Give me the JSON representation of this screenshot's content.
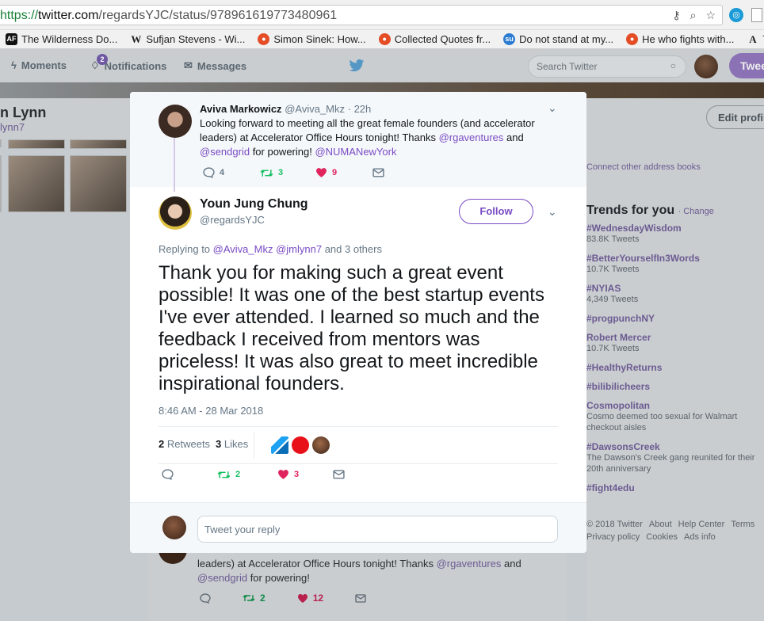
{
  "browser": {
    "url_protocol": "https://",
    "url_host": "twitter.com",
    "url_path": "/regardsYJC/status/978961619773480961",
    "bookmarks": [
      {
        "icon": "AF",
        "label": "The Wilderness Do..."
      },
      {
        "icon": "W",
        "label": "Sufjan Stevens - Wi..."
      },
      {
        "icon": "so",
        "label": "Simon Sinek: How..."
      },
      {
        "icon": "so",
        "label": "Collected Quotes fr..."
      },
      {
        "icon": "su",
        "label": "Do not stand at my..."
      },
      {
        "icon": "so",
        "label": "He who fights with..."
      },
      {
        "icon": "A",
        "label": "Th"
      }
    ]
  },
  "nav": {
    "moments": "Moments",
    "notifications": "Notifications",
    "notifications_badge": "2",
    "messages": "Messages",
    "search_placeholder": "Search Twitter",
    "tweet_button": "Twee"
  },
  "background": {
    "profile_name": "n Lynn",
    "profile_handle": "lynn7",
    "edit_profile": "Edit profil",
    "connect": "Connect other address books",
    "trends_title": "Trends for you",
    "trends_change": "· Change",
    "trends": [
      {
        "name": "#WednesdayWisdom",
        "count": "83.8K Tweets"
      },
      {
        "name": "#BetterYourselfIn3Words",
        "count": "10.7K Tweets"
      },
      {
        "name": "#NYIAS",
        "count": "4,349 Tweets"
      },
      {
        "name": "#progpunchNY",
        "count": ""
      },
      {
        "name": "Robert Mercer",
        "count": "10.7K Tweets"
      },
      {
        "name": "#HealthyReturns",
        "count": ""
      },
      {
        "name": "#bilibilicheers",
        "count": ""
      },
      {
        "name": "Cosmopolitan",
        "count": "Cosmo deemed too sexual for Walmart checkout aisles"
      },
      {
        "name": "#DawsonsCreek",
        "count": "The Dawson's Creek gang reunited for their 20th anniversary"
      },
      {
        "name": "#fight4edu",
        "count": ""
      }
    ],
    "footer_line1": [
      "© 2018 Twitter",
      "About",
      "Help Center",
      "Terms"
    ],
    "footer_line2": [
      "Privacy policy",
      "Cookies",
      "Ads info"
    ],
    "timeline_text_1": "leaders) at Accelerator Office Hours tonight!  Thanks ",
    "timeline_mention_1": "@rgaventures",
    "timeline_text_2": " and",
    "timeline_mention_2": "@sendgrid",
    "timeline_text_3": " for powering!",
    "timeline_retweets": "2",
    "timeline_likes": "12"
  },
  "parent_tweet": {
    "name": "Aviva Markowicz",
    "handle": "@Aviva_Mkz",
    "time": "· 22h",
    "text_1": "Looking forward to meeting all the great female founders (and accelerator leaders) at Accelerator Office Hours tonight!  Thanks ",
    "mention_1": "@rgaventures",
    "text_2": " and ",
    "mention_2": "@sendgrid",
    "text_3": " for powering! ",
    "mention_3": "@NUMANewYork",
    "replies": "4",
    "retweets": "3",
    "likes": "9"
  },
  "main_tweet": {
    "name": "Youn Jung Chung",
    "handle": "@regardsYJC",
    "follow": "Follow",
    "replying_prefix": "Replying to ",
    "replying_mentions": "@Aviva_Mkz @jmlynn7",
    "replying_suffix": " and 3 others",
    "text": "Thank you for making such a great event possible! It was one of the best startup events I've ever attended. I learned so much and the feedback I received from mentors was priceless! It was also great to meet incredible inspirational founders.",
    "timestamp": "8:46 AM - 28 Mar 2018",
    "retweets_count": "2",
    "retweets_label": "Retweets",
    "likes_count": "3",
    "likes_label": "Likes",
    "action_retweets": "2",
    "action_likes": "3"
  },
  "reply": {
    "placeholder": "Tweet your reply"
  },
  "colors": {
    "accent": "#794bc4",
    "retweet": "#17bf63",
    "like": "#e0245e"
  }
}
